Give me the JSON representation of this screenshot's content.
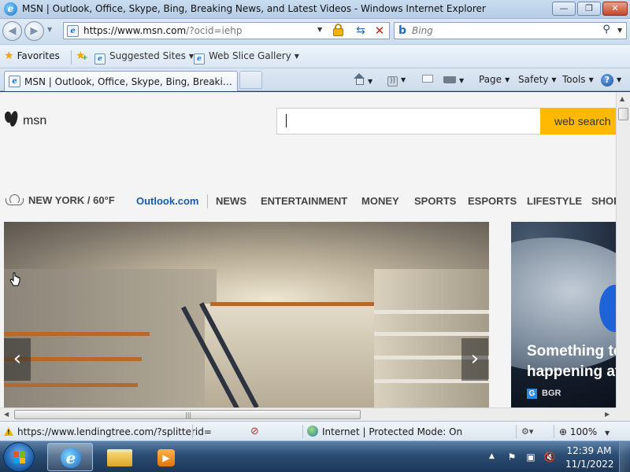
{
  "window": {
    "title": "MSN | Outlook, Office, Skype, Bing, Breaking News, and Latest Videos - Windows Internet Explorer",
    "minimize": "—",
    "maximize": "❐",
    "close": "✕"
  },
  "address_bar": {
    "url_host": "https://www.msn.com",
    "url_rest": "/?ocid=iehp",
    "refresh_glyph": "⇆",
    "stop_glyph": "✕"
  },
  "search_bar": {
    "placeholder": "Bing",
    "search_glyph": "⚲"
  },
  "favorites_bar": {
    "favorites_label": "Favorites",
    "links": [
      {
        "label": "Suggested Sites"
      },
      {
        "label": "Web Slice Gallery"
      }
    ]
  },
  "tabs": {
    "active_title": "MSN | Outlook, Office, Skype, Bing, Breaking News, and Latest Videos"
  },
  "command_bar": {
    "page": "Page",
    "safety": "Safety",
    "tools": "Tools",
    "help": "?"
  },
  "page": {
    "brand": "msn",
    "search_button": "web search",
    "weather": "NEW YORK / 60°F",
    "nav": [
      "Outlook.com",
      "NEWS",
      "ENTERTAINMENT",
      "MONEY",
      "SPORTS",
      "ESPORTS",
      "LIFESTYLE",
      "SHOPPING"
    ],
    "hero": {
      "prev": "‹",
      "next": "›"
    },
    "side_card": {
      "headline_line1": "Something to",
      "headline_line2": "happening at",
      "source": "BGR",
      "source_icon": "G"
    }
  },
  "status_bar": {
    "url": "https://www.lendingtree.com/?splitterid=",
    "zone": "Internet | Protected Mode: On",
    "zoom": "100%"
  },
  "taskbar": {
    "time": "12:39 AM",
    "date": "11/1/2022"
  },
  "colors": {
    "search_button": "#ffb900",
    "outlook_link": "#1a5aa8",
    "hero_tint": "#cfc6b1"
  }
}
